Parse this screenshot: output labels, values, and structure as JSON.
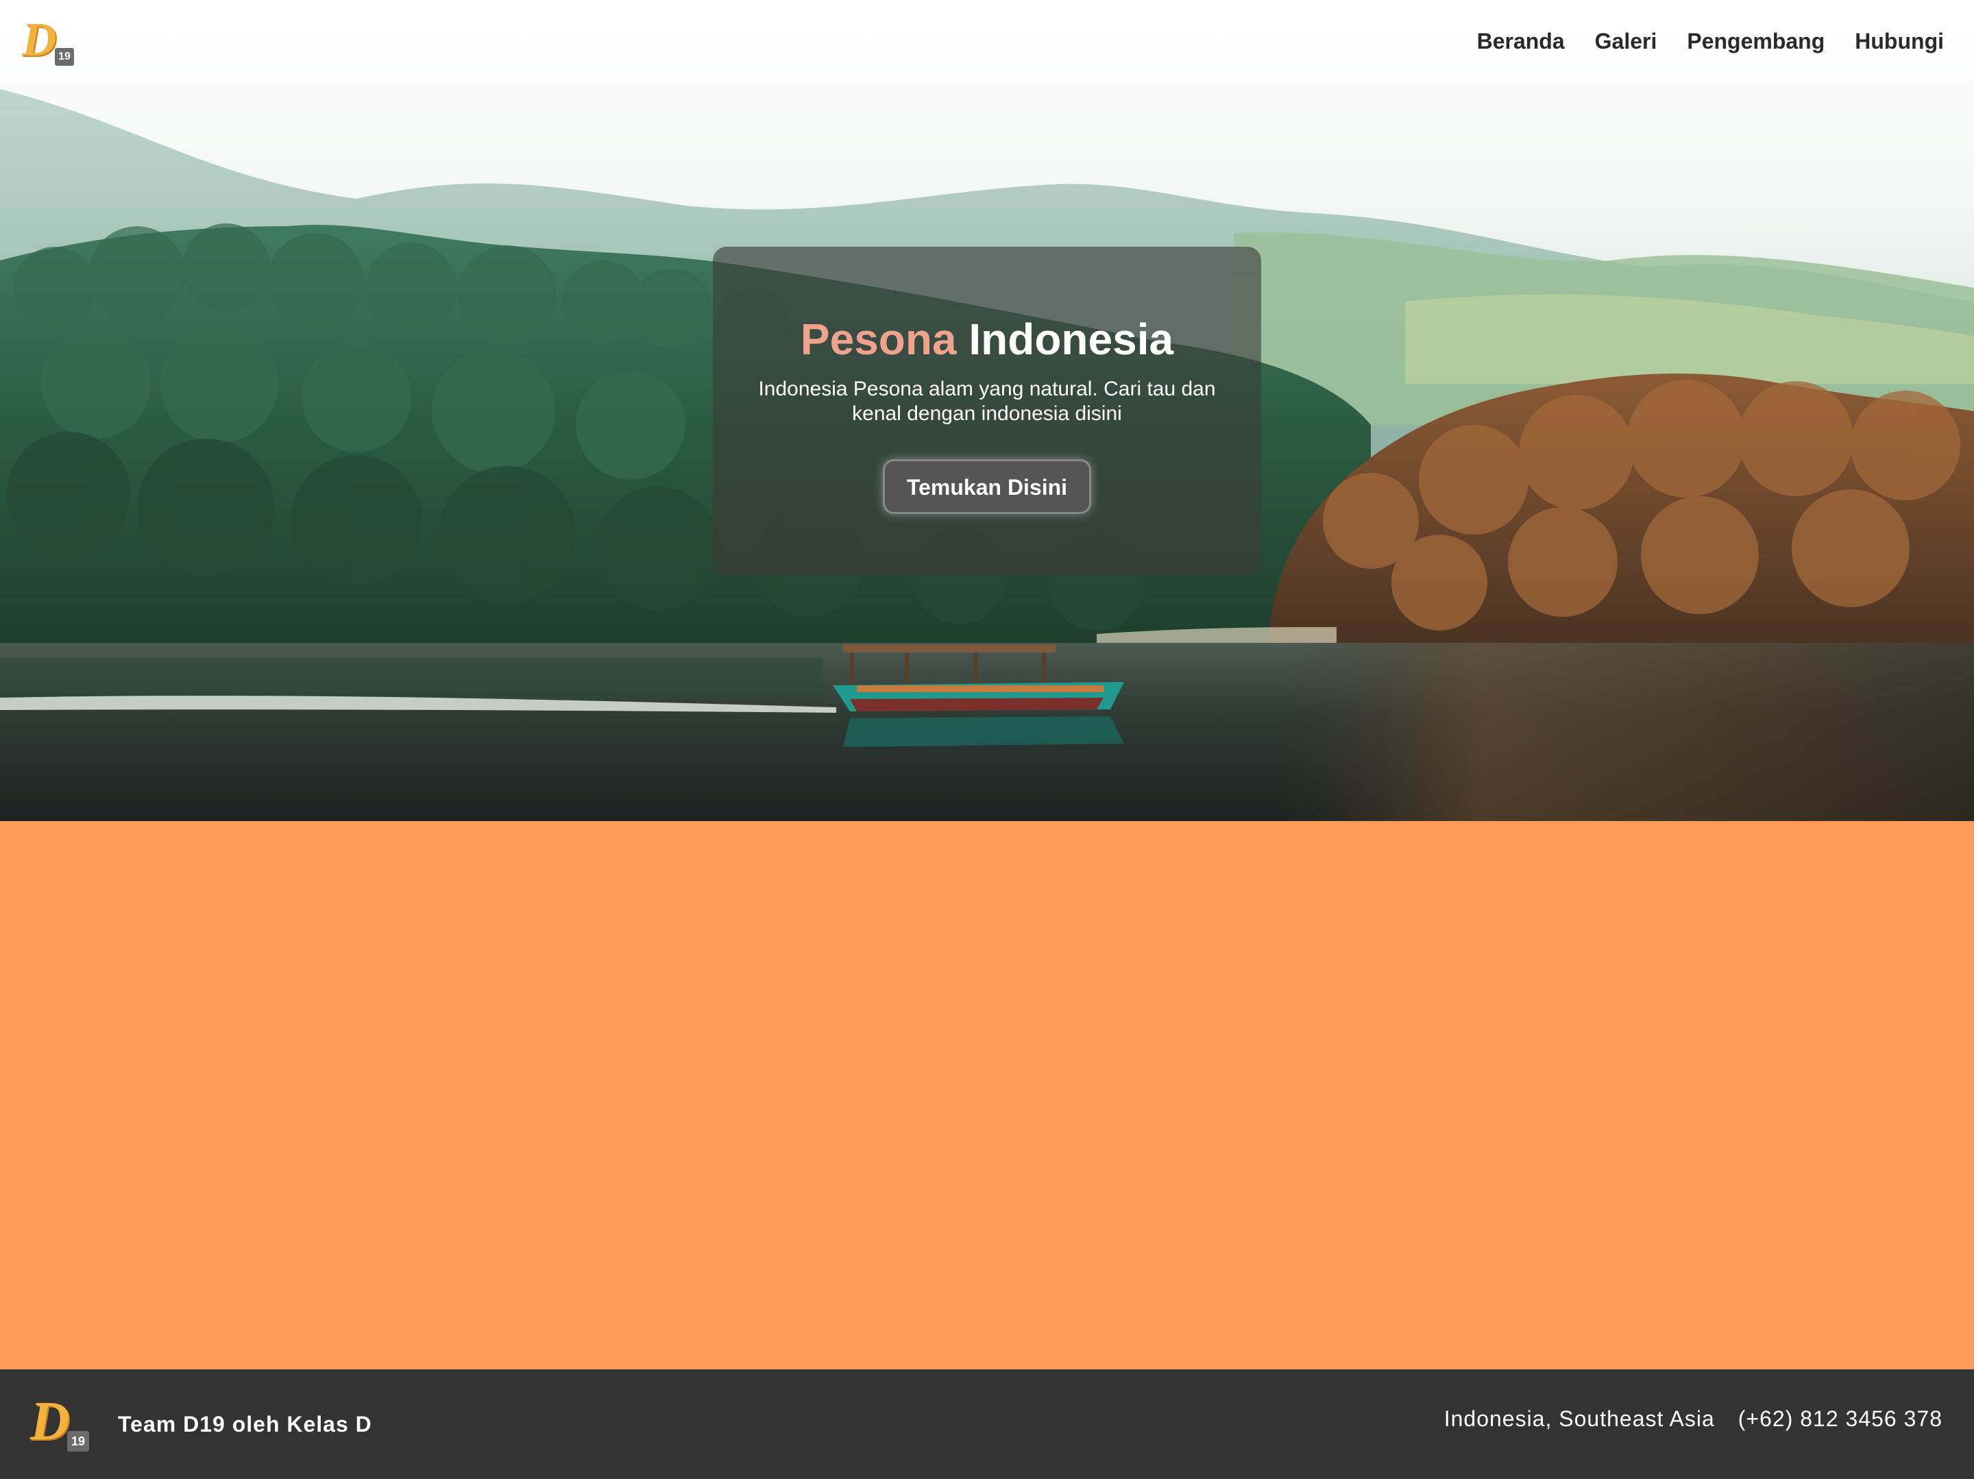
{
  "brand": {
    "logo_letter": "D",
    "logo_badge": "19"
  },
  "nav": {
    "items": [
      "Beranda",
      "Galeri",
      "Pengembang",
      "Hubungi"
    ]
  },
  "hero": {
    "title_accent": "Pesona",
    "title_rest": "Indonesia",
    "subtitle": "Indonesia Pesona alam yang natural. Cari tau dan kenal dengan indonesia disini",
    "cta_label": "Temukan Disini"
  },
  "colors": {
    "accent_title": "#f0a28c",
    "main_bg": "#ff9b5b",
    "footer_bg": "#333333",
    "logo": "#f5b13d"
  },
  "footer": {
    "team": "Team D19 oleh Kelas D",
    "location": "Indonesia, Southeast Asia",
    "phone": "(+62) 812 3456 378"
  }
}
